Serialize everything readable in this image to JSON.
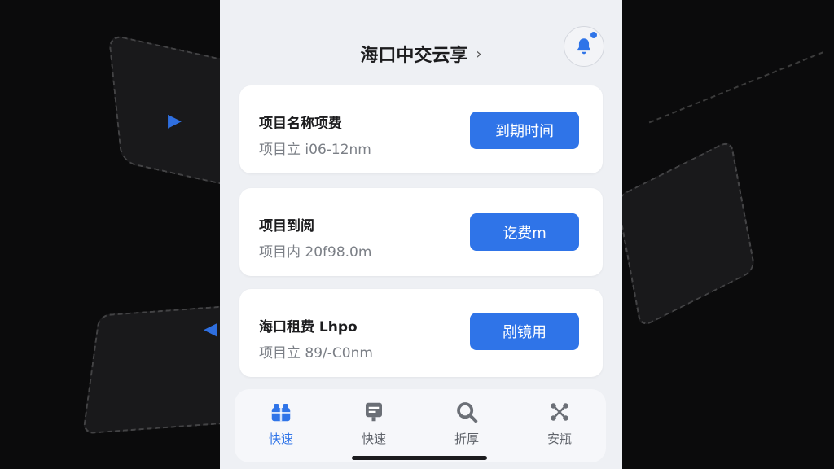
{
  "header": {
    "title": "海口中交云享",
    "chevron": "›"
  },
  "cards": [
    {
      "name": "项目名称项费",
      "meta": "项目立 i06-12nm",
      "button": "到期时间"
    },
    {
      "name": "项目到阅",
      "meta": "项目内 20f98.0m",
      "button": "讫费m"
    },
    {
      "name": "海口租费 Lhpo",
      "meta": "项目立 89/-C0nm",
      "button": "剐镜用"
    }
  ],
  "tabbar": {
    "items": [
      {
        "label": "快速",
        "icon": "gift-icon",
        "active": true
      },
      {
        "label": "快速",
        "icon": "document-icon",
        "active": false
      },
      {
        "label": "折厚",
        "icon": "search-icon",
        "active": false
      },
      {
        "label": "安瓶",
        "icon": "network-icon",
        "active": false
      }
    ]
  },
  "colors": {
    "accent": "#2f74e8",
    "background": "#eef0f4",
    "card": "#ffffff"
  }
}
